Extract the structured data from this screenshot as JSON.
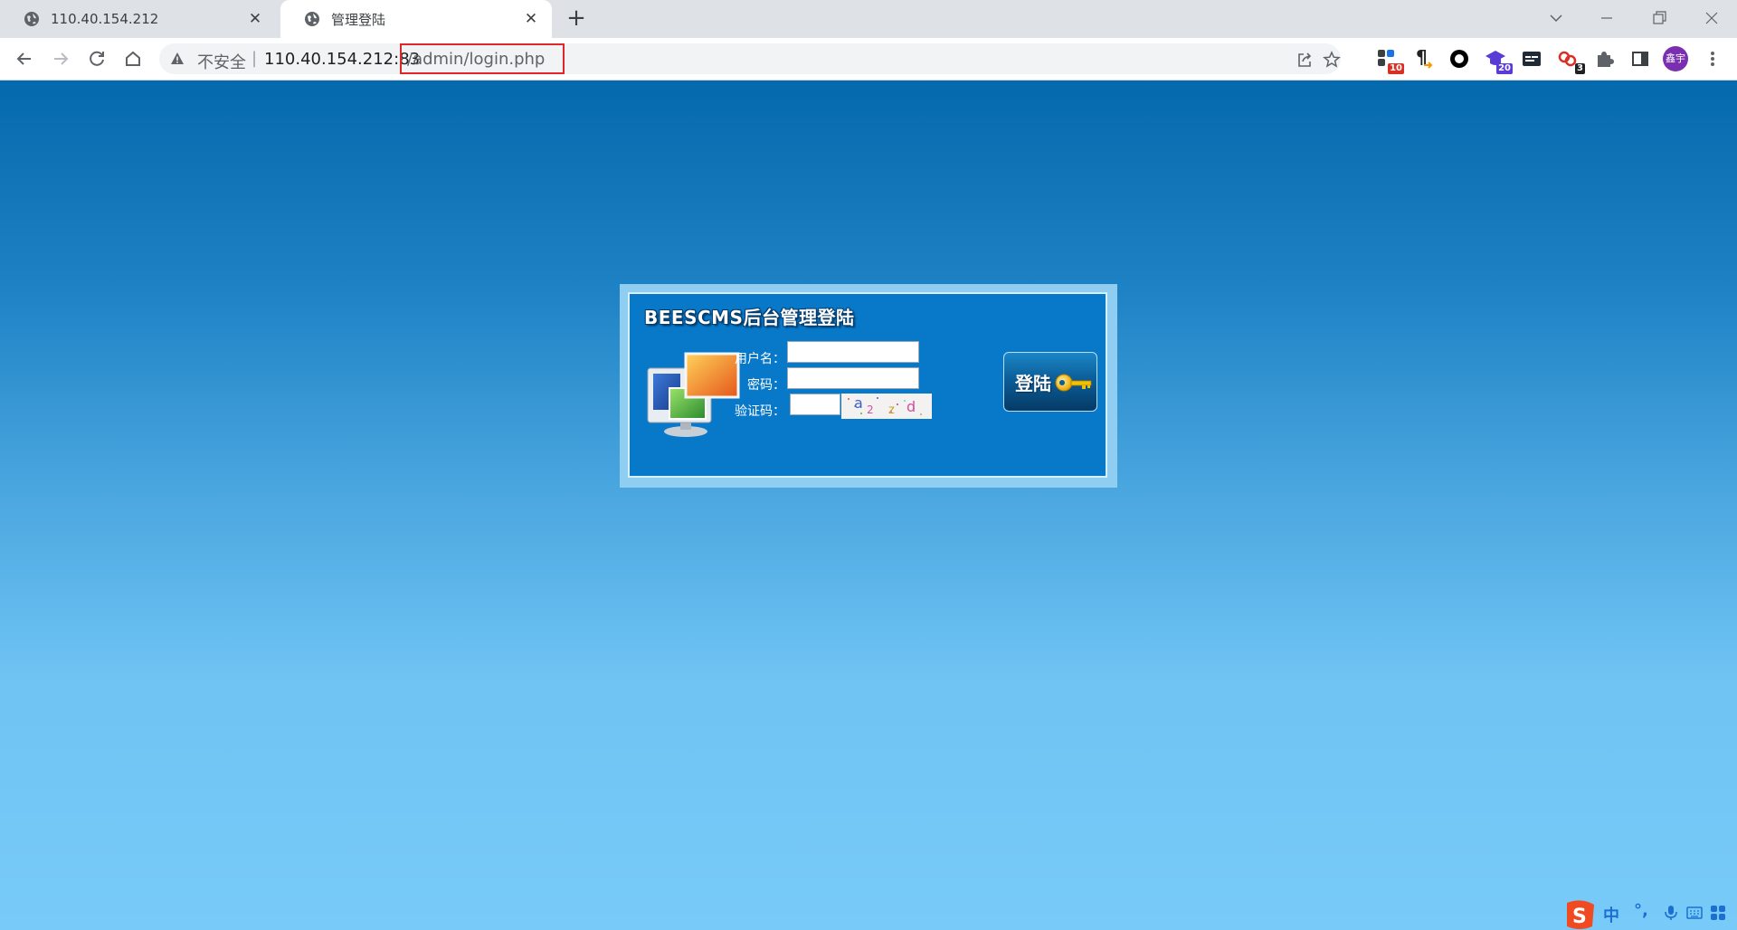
{
  "browser": {
    "tabs": [
      {
        "title": "110.40.154.212",
        "favicon": "globe-icon"
      },
      {
        "title": "管理登陆",
        "favicon": "globe-icon",
        "active": true
      }
    ],
    "new_tab_label": "+",
    "security_label": "不安全",
    "separator": "|",
    "url_host": "110.40.154.212:83",
    "url_path": "/admin/login.php",
    "extensions": [
      {
        "icon": "grid-extension-icon",
        "badge": "10",
        "badge_color": "#d93025"
      },
      {
        "icon": "pilcrow-extension-icon",
        "badge": ""
      },
      {
        "icon": "circle-extension-icon",
        "badge": ""
      },
      {
        "icon": "graduation-cap-extension-icon",
        "badge": "20",
        "badge_color": "#5b3bd6"
      },
      {
        "icon": "terminal-extension-icon",
        "badge": ""
      },
      {
        "icon": "link-extension-icon",
        "badge": "3",
        "badge_color": "#202124"
      },
      {
        "icon": "puzzle-icon",
        "badge": ""
      },
      {
        "icon": "side-panel-icon",
        "badge": ""
      }
    ],
    "profile_avatar_text": "鑫宇"
  },
  "login": {
    "title": "BEESCMS后台管理登陆",
    "username_label": "用户名：",
    "password_label": "密码：",
    "captcha_label": "验证码：",
    "username_value": "",
    "password_value": "",
    "captcha_value": "",
    "captcha_text": "a2 z d",
    "button_label": "登陆"
  },
  "ime": {
    "mode": "中",
    "punct": "°,"
  },
  "colors": {
    "page_top": "#0569ad",
    "page_bottom": "#78cbf8",
    "login_panel": "#0878c9",
    "url_highlight_border": "#e0262b"
  }
}
